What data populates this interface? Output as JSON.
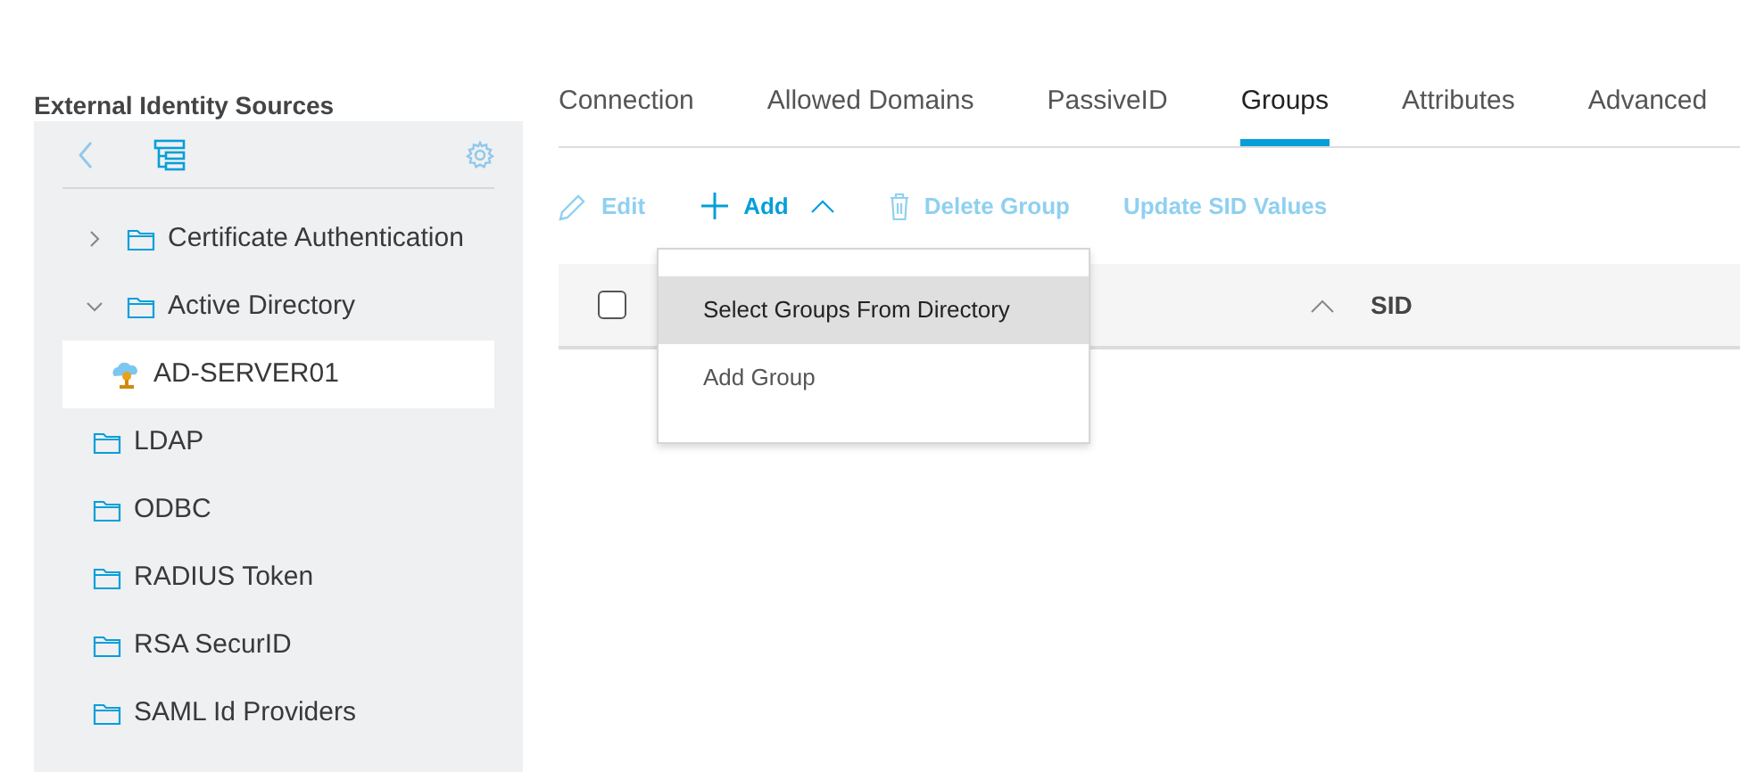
{
  "sidebar": {
    "title": "External Identity Sources",
    "tree": [
      {
        "label": "Certificate Authentication",
        "kind": "folder",
        "expanded": false,
        "selected": false
      },
      {
        "label": "Active Directory",
        "kind": "folder",
        "expanded": true,
        "selected": false,
        "children": [
          {
            "label": "AD-SERVER01",
            "kind": "server",
            "selected": true
          }
        ]
      },
      {
        "label": "LDAP",
        "kind": "folder",
        "selected": false
      },
      {
        "label": "ODBC",
        "kind": "folder",
        "selected": false
      },
      {
        "label": "RADIUS Token",
        "kind": "folder",
        "selected": false
      },
      {
        "label": "RSA SecurID",
        "kind": "folder",
        "selected": false
      },
      {
        "label": "SAML Id Providers",
        "kind": "folder",
        "selected": false
      }
    ]
  },
  "tabs": [
    {
      "label": "Connection",
      "selected": false
    },
    {
      "label": "Allowed Domains",
      "selected": false
    },
    {
      "label": "PassiveID",
      "selected": false
    },
    {
      "label": "Groups",
      "selected": true
    },
    {
      "label": "Attributes",
      "selected": false
    },
    {
      "label": "Advanced",
      "selected": false
    }
  ],
  "toolbar": [
    {
      "kind": "edit",
      "label": "Edit",
      "disabled": true
    },
    {
      "kind": "add",
      "label": "Add",
      "disabled": false,
      "expanded": true
    },
    {
      "kind": "delete",
      "label": "Delete Group",
      "disabled": true
    },
    {
      "kind": "plain",
      "label": "Update SID Values",
      "disabled": true
    }
  ],
  "table": {
    "select_all_checked": false,
    "columns": [
      {
        "label": "SID"
      }
    ]
  },
  "add_menu": [
    {
      "label": "Select Groups From Directory",
      "selected": true
    },
    {
      "label": "Add Group",
      "selected": false
    }
  ]
}
